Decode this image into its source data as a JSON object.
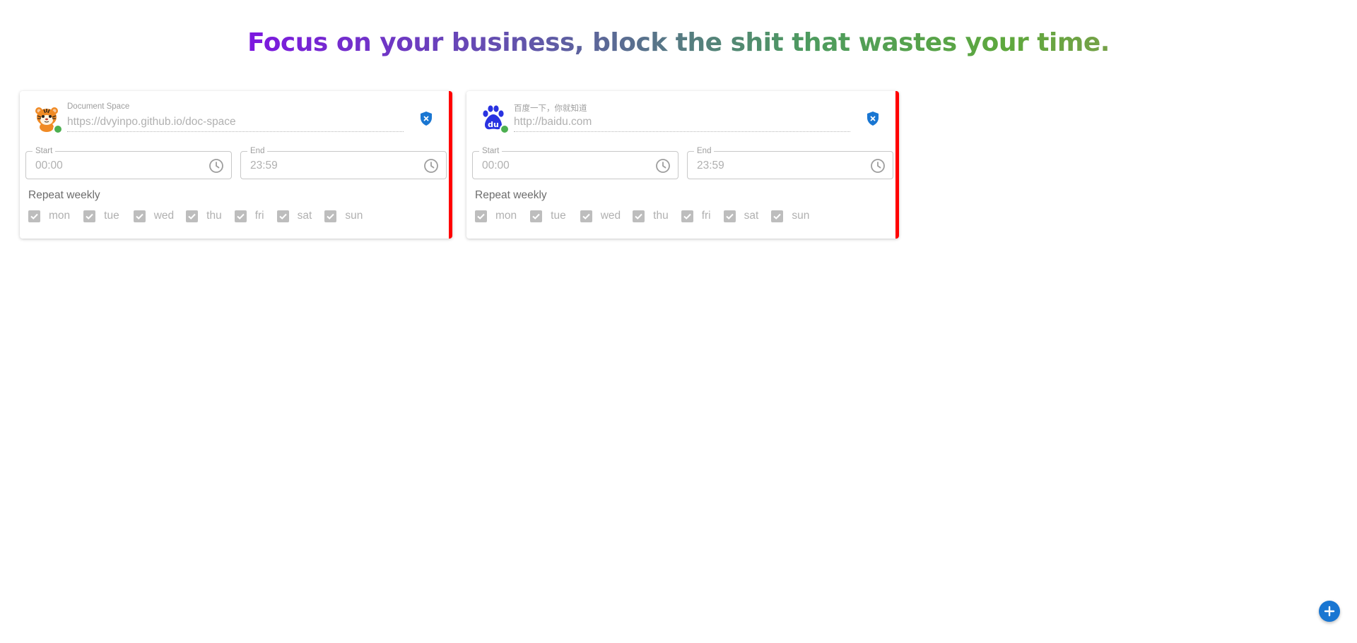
{
  "header": {
    "tagline": "Focus on your business, block the shit that wastes your time."
  },
  "cards": [
    {
      "icon": "tiger-logo-icon",
      "name": "Document Space",
      "url": "https://dvyinpo.github.io/doc-space",
      "start_label": "Start",
      "start": "00:00",
      "end_label": "End",
      "end": "23:59",
      "repeat_label": "Repeat weekly",
      "days": [
        "mon",
        "tue",
        "wed",
        "thu",
        "fri",
        "sat",
        "sun"
      ],
      "days_checked": [
        true,
        true,
        true,
        true,
        true,
        true,
        true
      ]
    },
    {
      "icon": "baidu-paw-icon",
      "name": "百度一下，你就知道",
      "url": "http://baidu.com",
      "start_label": "Start",
      "start": "00:00",
      "end_label": "End",
      "end": "23:59",
      "repeat_label": "Repeat weekly",
      "days": [
        "mon",
        "tue",
        "wed",
        "thu",
        "fri",
        "sat",
        "sun"
      ],
      "days_checked": [
        true,
        true,
        true,
        true,
        true,
        true,
        true
      ]
    }
  ],
  "icons": {
    "status": "online-dot-icon",
    "block": "shield-block-icon",
    "time": "clock-icon",
    "checkbox": "checkbox-checked-icon",
    "add": "plus-icon"
  },
  "colors": {
    "accent": "#1976d2",
    "active_bar": "#ff0000",
    "online": "#4caf50",
    "baidu_blue": "#2932e1"
  }
}
